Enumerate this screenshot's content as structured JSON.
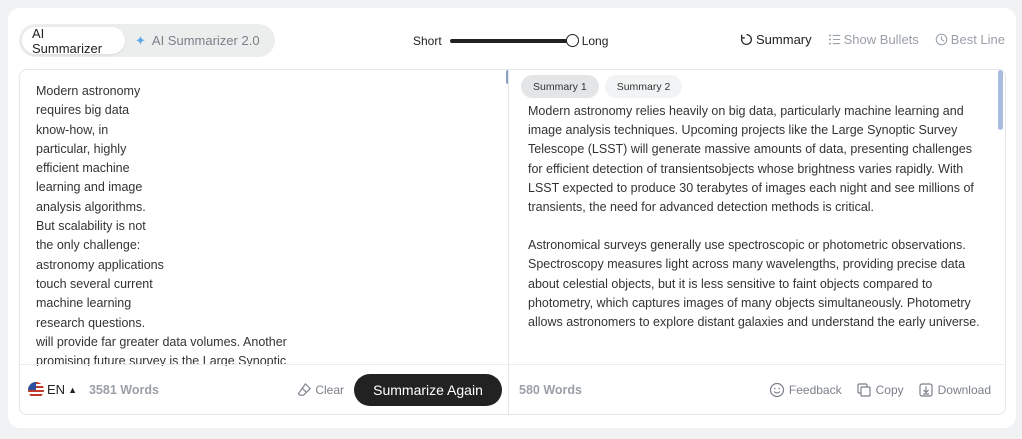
{
  "modes": {
    "tab1": "AI Summarizer",
    "tab2": "AI Summarizer 2.0",
    "tab2_icon": "sparkle-icon"
  },
  "length": {
    "short_label": "Short",
    "long_label": "Long",
    "value": 1.0
  },
  "output_modes": {
    "summary": "Summary",
    "bullets": "Show Bullets",
    "best_line": "Best Line",
    "active": "summary"
  },
  "input": {
    "text": "Modern astronomy\nrequires big data\nknow-how, in\nparticular, highly\nefficient machine\nlearning and image\nanalysis algorithms.\nBut scalability is not\nthe only challenge:\nastronomy applications\ntouch several current\nmachine learning\nresearch questions.\nwill provide far greater data volumes. Another\npromising future survey is the Large Synoptic"
  },
  "input_footer": {
    "language": "EN",
    "word_count": "3581 Words",
    "clear_label": "Clear",
    "summarize_label": "Summarize Again"
  },
  "summary": {
    "tab1": "Summary 1",
    "tab2": "Summary 2",
    "paragraph1": "Modern astronomy relies heavily on big data, particularly machine learning and image analysis techniques. Upcoming projects like the Large Synoptic Survey Telescope (LSST) will generate massive amounts of data, presenting challenges for efficient detection of transientsobjects whose brightness varies rapidly. With LSST expected to produce 30 terabytes of images each night and see millions of transients, the need for advanced detection methods is critical.",
    "paragraph2": "Astronomical surveys generally use spectroscopic or photometric observations. Spectroscopy measures light across many wavelengths, providing precise data about celestial objects, but it is less sensitive to faint objects compared to photometry, which captures images of many objects simultaneously. Photometry allows astronomers to explore distant galaxies and understand the early universe."
  },
  "output_footer": {
    "word_count": "580 Words",
    "feedback_label": "Feedback",
    "copy_label": "Copy",
    "download_label": "Download"
  }
}
